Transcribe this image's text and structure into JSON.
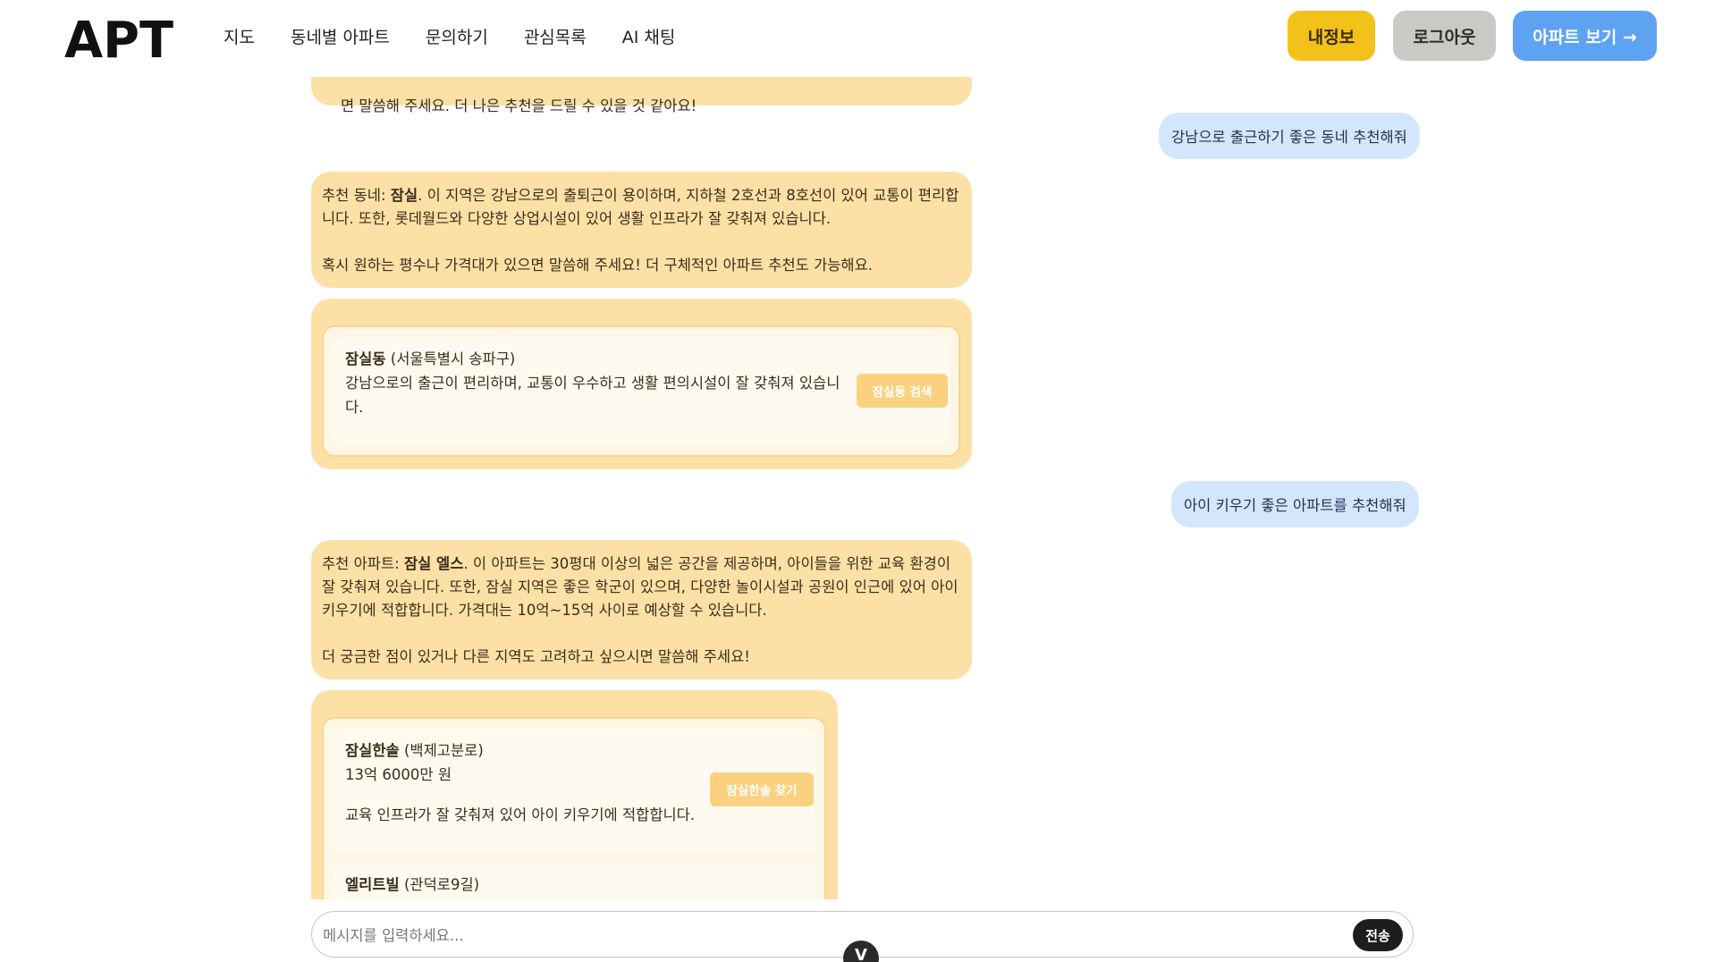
{
  "header": {
    "logo_text": "APT",
    "nav": [
      "지도",
      "동네별 아파트",
      "문의하기",
      "관심목록",
      "AI 채팅"
    ],
    "myinfo_label": "내정보",
    "logout_label": "로그아웃",
    "apt_view_label": "아파트 보기 →"
  },
  "chat": {
    "partial_top_text": "면 말씀해 주세요. 더 나은 추천을 드릴 수 있을 것 같아요!",
    "user1": "강남으로 출근하기 좋은 동네 추천해줘",
    "ai1": {
      "prefix": "추천 동네: ",
      "bold": "잠실",
      "body": ". 이 지역은 강남으로의 출퇴근이 용이하며, 지하철 2호선과 8호선이 있어 교통이 편리합니다. 또한, 롯데월드와 다양한 상업시설이 있어 생활 인프라가 잘 갖춰져 있습니다.\n\n혹시 원하는 평수나 가격대가 있으면 말씀해 주세요! 더 구체적인 아파트 추천도 가능해요."
    },
    "card1": {
      "name": "잠실동",
      "region": " (서울특별시 송파구)",
      "desc": "강남으로의 출근이 편리하며, 교통이 우수하고 생활 편의시설이 잘 갖춰져 있습니다.",
      "button": "잠실동 검색"
    },
    "user2": "아이 키우기 좋은 아파트를 추천해줘",
    "ai2": {
      "prefix": "추천 아파트: ",
      "bold": "잠실 엘스",
      "body": ". 이 아파트는 30평대 이상의 넓은 공간을 제공하며, 아이들을 위한 교육 환경이 잘 갖춰져 있습니다. 또한, 잠실 지역은 좋은 학군이 있으며, 다양한 놀이시설과 공원이 인근에 있어 아이 키우기에 적합합니다. 가격대는 10억~15억 사이로 예상할 수 있습니다.\n\n더 궁금한 점이 있거나 다른 지역도 고려하고 싶으시면 말씀해 주세요!"
    },
    "apt_cards": [
      {
        "name": "잠실한솔",
        "road": " (백제고분로)",
        "price": "13억 6000만 원",
        "desc": "교육 인프라가 잘 갖춰져 있어 아이 키우기에 적합합니다.",
        "button": "잠실한솔 찾기"
      },
      {
        "name": "엘리트빌",
        "road": " (관덕로9길)"
      }
    ]
  },
  "input": {
    "placeholder": "메시지를 입력하세요...",
    "send_label": "전송",
    "scroll_glyph": "V"
  },
  "colors": {
    "ai_bubble": "#fde0a6",
    "user_bubble": "#d3e6fc",
    "myinfo": "#f2c21b",
    "logout": "#c9c9c5",
    "apt_button": "#5ea2f2"
  }
}
